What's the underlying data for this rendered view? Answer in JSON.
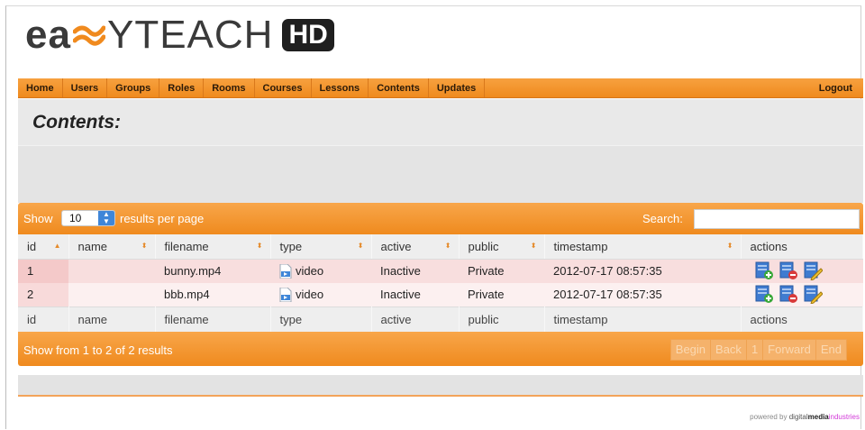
{
  "brand": {
    "name_part1": "ea",
    "name_part2": "Y",
    "name_part3": "TEACH",
    "badge": "HD"
  },
  "nav": {
    "items": [
      "Home",
      "Users",
      "Groups",
      "Roles",
      "Rooms",
      "Courses",
      "Lessons",
      "Contents",
      "Updates"
    ],
    "logout": "Logout"
  },
  "page": {
    "title": "Contents:"
  },
  "table_controls": {
    "show_label": "Show",
    "per_page_value": "10",
    "per_page_label": "results per page",
    "search_label": "Search:",
    "search_value": ""
  },
  "table": {
    "columns": [
      "id",
      "name",
      "filename",
      "type",
      "active",
      "public",
      "timestamp",
      "actions"
    ],
    "rows": [
      {
        "id": "1",
        "name": "",
        "filename": "bunny.mp4",
        "type": "video",
        "active": "Inactive",
        "public": "Private",
        "timestamp": "2012-07-17 08:57:35"
      },
      {
        "id": "2",
        "name": "",
        "filename": "bbb.mp4",
        "type": "video",
        "active": "Inactive",
        "public": "Private",
        "timestamp": "2012-07-17 08:57:35"
      }
    ]
  },
  "footer": {
    "info": "Show from 1 to 2 of 2 results",
    "pager": [
      "Begin",
      "Back",
      "1",
      "Forward",
      "End"
    ]
  },
  "powered": {
    "prefix": "powered by",
    "digital": "digital",
    "media": "media",
    "industries": "industries"
  },
  "colors": {
    "accent": "#ef8a1e",
    "row_odd": "#f8dede",
    "row_even": "#fcf0f0"
  }
}
